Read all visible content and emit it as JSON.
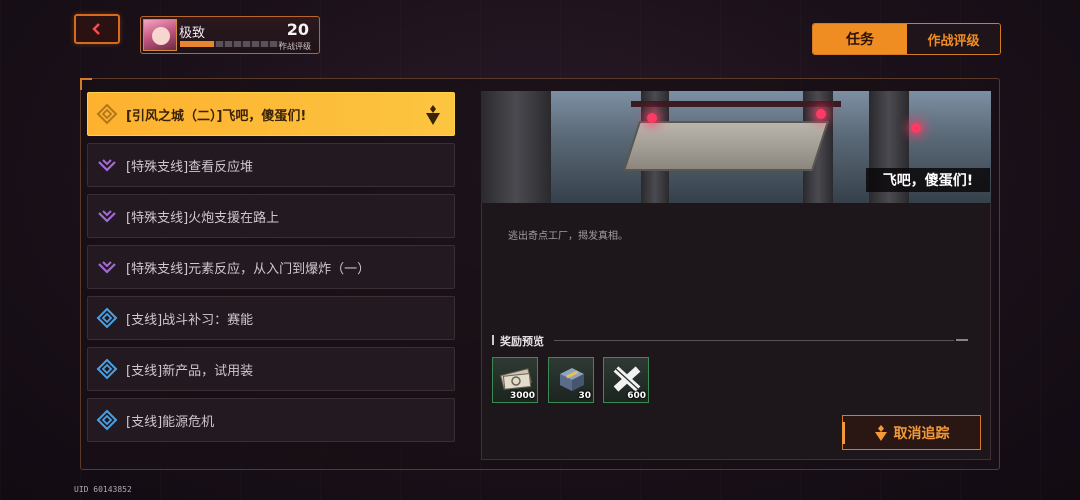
{
  "player": {
    "name": "极致",
    "level": "20",
    "rank_label": "作战评级",
    "rank_progress": 0.33
  },
  "top_tabs": [
    {
      "label": "任务",
      "active": true
    },
    {
      "label": "作战评级",
      "active": false
    }
  ],
  "missions": [
    {
      "label": "[引风之城（二）]飞吧，傻蛋们!",
      "type": "main",
      "active": true,
      "icon": "main-quest-diamond-icon"
    },
    {
      "label": "[特殊支线]查看反应堆",
      "type": "special",
      "active": false,
      "icon": "special-quest-icon"
    },
    {
      "label": "[特殊支线]火炮支援在路上",
      "type": "special",
      "active": false,
      "icon": "special-quest-icon"
    },
    {
      "label": "[特殊支线]元素反应，从入门到爆炸（一）",
      "type": "special",
      "active": false,
      "icon": "special-quest-icon"
    },
    {
      "label": "[支线]战斗补习：赛能",
      "type": "side",
      "active": false,
      "icon": "side-quest-icon"
    },
    {
      "label": "[支线]新产品，试用装",
      "type": "side",
      "active": false,
      "icon": "side-quest-icon"
    },
    {
      "label": "[支线]能源危机",
      "type": "side",
      "active": false,
      "icon": "side-quest-icon"
    }
  ],
  "detail": {
    "banner_title": "飞吧，傻蛋们!",
    "description": "逃出奇点工厂，揭发真相。",
    "reward_title": "奖励预览",
    "rewards": [
      {
        "icon": "cash-bundle-icon",
        "qty": "3000"
      },
      {
        "icon": "supply-crate-icon",
        "qty": "30"
      },
      {
        "icon": "exp-chip-icon",
        "qty": "600"
      }
    ],
    "untrack_label": "取消追踪"
  },
  "uid": "UID 60143852",
  "colors": {
    "accent": "#f08d22",
    "active_mission": "#fdb12f",
    "special_icon": "#a46ad8",
    "side_icon": "#4aa0e6",
    "reward_border": "#3a8a52"
  }
}
